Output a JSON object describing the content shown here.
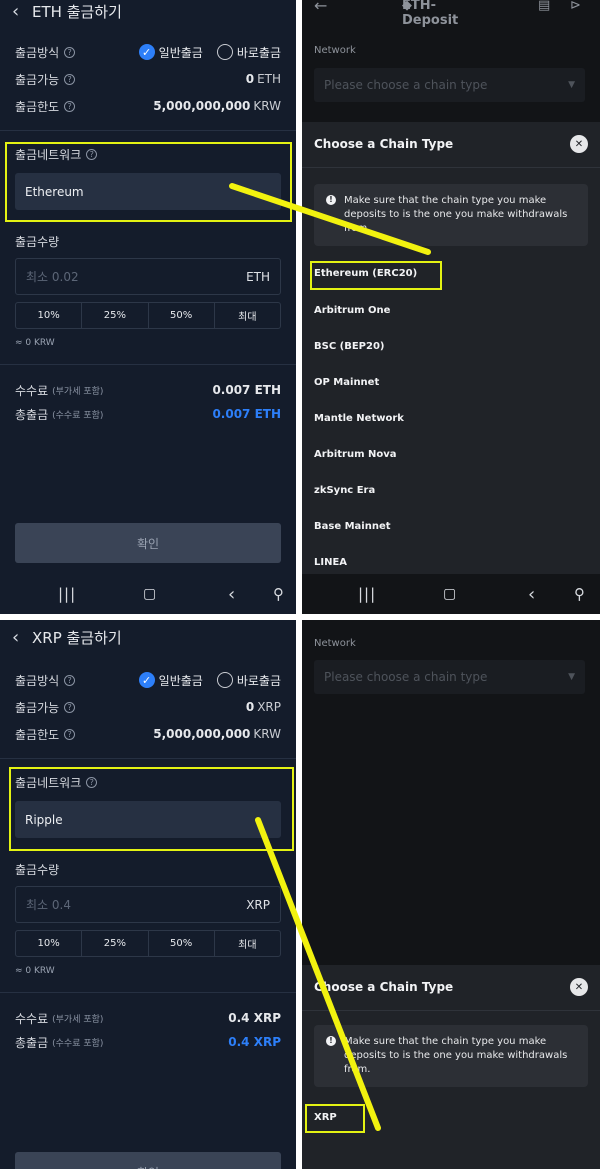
{
  "eth_withdraw": {
    "title": "ETH 출금하기",
    "method_label": "출금방식",
    "method_normal": "일반출금",
    "method_instant": "바로출금",
    "available_label": "출금가능",
    "available_value": "0",
    "available_unit": "ETH",
    "limit_label": "출금한도",
    "limit_value": "5,000,000,000",
    "limit_unit": "KRW",
    "network_label": "출금네트워크",
    "network_value": "Ethereum",
    "amount_label": "출금수량",
    "amount_placeholder": "최소 0.02",
    "amount_unit": "ETH",
    "pct_buttons": [
      "10%",
      "25%",
      "50%",
      "최대"
    ],
    "approx_krw": "≈ 0 KRW",
    "fee_label": "수수료",
    "fee_sub": "(부가세 포함)",
    "fee_value": "0.007 ETH",
    "total_label": "총출금",
    "total_sub": "(수수료 포함)",
    "total_value": "0.007 ETH",
    "confirm_label": "확인"
  },
  "eth_deposit": {
    "title": "ETH-Deposit",
    "network_label": "Network",
    "network_placeholder": "Please choose a chain type",
    "sheet_title": "Choose a Chain Type",
    "notice": "Make sure that the chain type you make deposits to is the one you make withdrawals from.",
    "chains": [
      "Ethereum (ERC20)",
      "Arbitrum One",
      "BSC (BEP20)",
      "OP Mainnet",
      "Mantle Network",
      "Arbitrum Nova",
      "zkSync Era",
      "Base Mainnet",
      "LINEA"
    ]
  },
  "xrp_withdraw": {
    "title": "XRP 출금하기",
    "method_label": "출금방식",
    "method_normal": "일반출금",
    "method_instant": "바로출금",
    "available_label": "출금가능",
    "available_value": "0",
    "available_unit": "XRP",
    "limit_label": "출금한도",
    "limit_value": "5,000,000,000",
    "limit_unit": "KRW",
    "network_label": "출금네트워크",
    "network_value": "Ripple",
    "amount_label": "출금수량",
    "amount_placeholder": "최소 0.4",
    "amount_unit": "XRP",
    "pct_buttons": [
      "10%",
      "25%",
      "50%",
      "최대"
    ],
    "approx_krw": "≈ 0 KRW",
    "fee_label": "수수료",
    "fee_sub": "(부가세 포함)",
    "fee_value": "0.4 XRP",
    "total_label": "총출금",
    "total_sub": "(수수료 포함)",
    "total_value": "0.4 XRP",
    "confirm_label": "확인"
  },
  "xrp_deposit": {
    "network_label": "Network",
    "network_placeholder": "Please choose a chain type",
    "sheet_title": "Choose a Chain Type",
    "notice": "Make sure that the chain type you make deposits to is the one you make withdrawals from.",
    "chains": [
      "XRP"
    ]
  },
  "colors": {
    "highlight": "#e3f213",
    "accent_blue": "#2d7ff9",
    "withdraw_bg": "#141c2b",
    "deposit_bg": "#121417"
  }
}
